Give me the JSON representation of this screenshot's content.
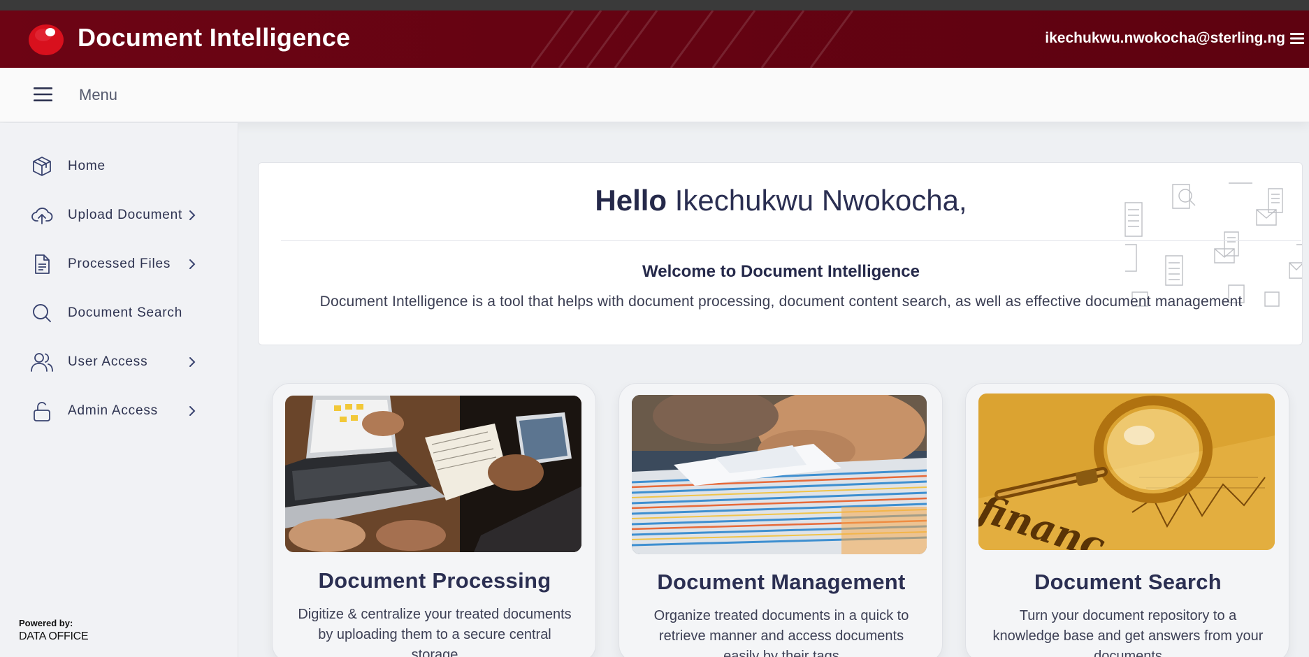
{
  "header": {
    "app_title": "Document Intelligence",
    "user_email": "ikechukwu.nwokocha@sterling.ng",
    "brand_color": "#650312",
    "logo_color": "#d8101d"
  },
  "menubar": {
    "menu_label": "Menu"
  },
  "sidebar": {
    "items": [
      {
        "label": "Home",
        "icon": "box-icon",
        "has_submenu": false
      },
      {
        "label": "Upload Document",
        "icon": "cloud-upload-icon",
        "has_submenu": true
      },
      {
        "label": "Processed Files",
        "icon": "file-text-icon",
        "has_submenu": true
      },
      {
        "label": "Document Search",
        "icon": "search-icon",
        "has_submenu": false
      },
      {
        "label": "User Access",
        "icon": "users-icon",
        "has_submenu": true
      },
      {
        "label": "Admin Access",
        "icon": "unlock-icon",
        "has_submenu": true
      }
    ],
    "powered_by": "Powered by:",
    "powered_org": "DATA OFFICE"
  },
  "welcome": {
    "greeting": "Hello",
    "user_name": "Ikechukwu Nwokocha,",
    "title": "Welcome to Document Intelligence",
    "description": "Document Intelligence is a tool that helps with document processing, document content search, as well as effective document management"
  },
  "features": [
    {
      "title": "Document Processing",
      "description": "Digitize & centralize your treated documents by uploading them to a secure central storage",
      "image": "laptop-notebook-photo"
    },
    {
      "title": "Document Management",
      "description": "Organize treated documents in a quick to retrieve manner and access documents easily by their tags",
      "image": "document-stack-photo"
    },
    {
      "title": "Document Search",
      "description": "Turn your document repository to a knowledge base and get answers from your documents",
      "image": "magnifier-financial-photo"
    }
  ]
}
